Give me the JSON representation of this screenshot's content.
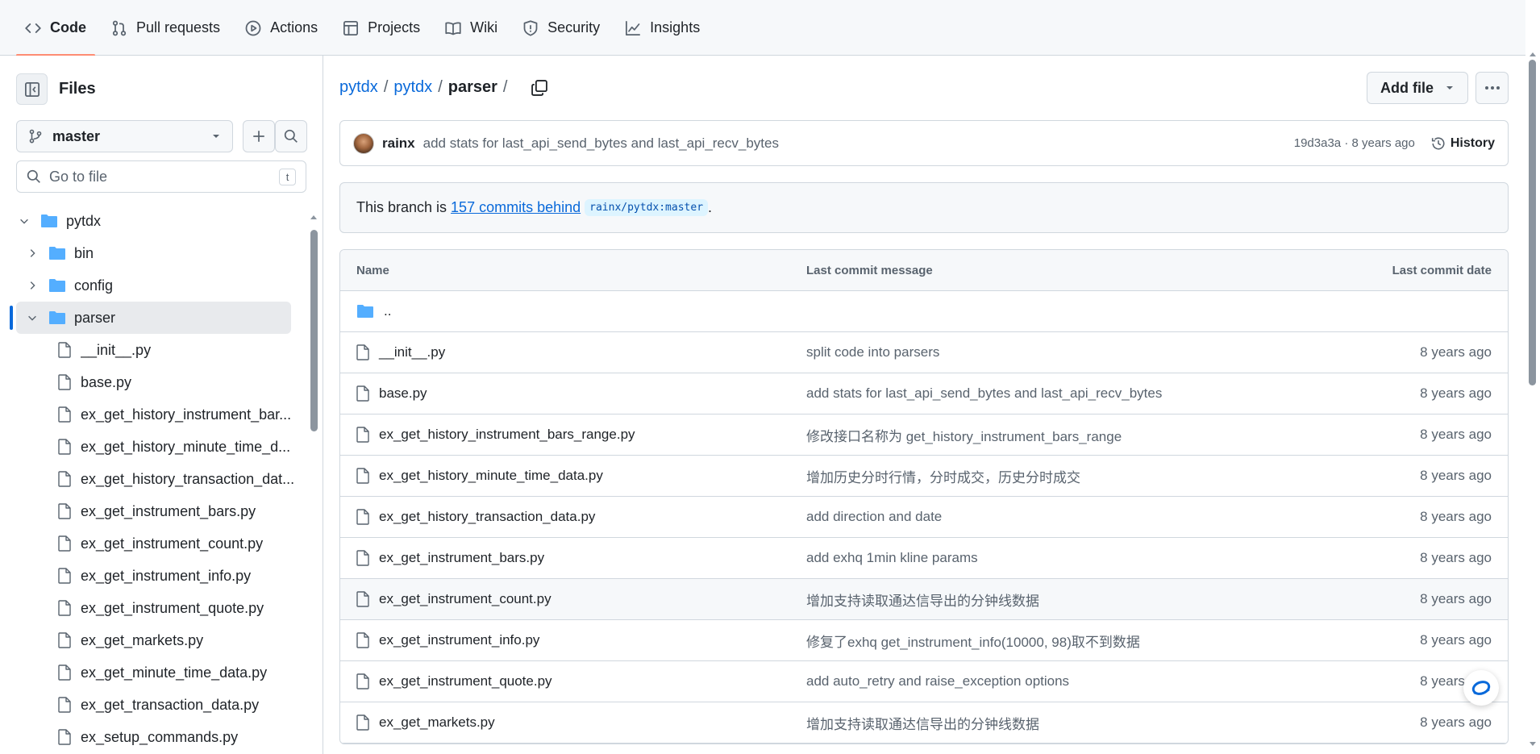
{
  "nav": {
    "tabs": [
      {
        "label": "Code",
        "icon": "code-icon"
      },
      {
        "label": "Pull requests",
        "icon": "pull-request-icon"
      },
      {
        "label": "Actions",
        "icon": "play-icon"
      },
      {
        "label": "Projects",
        "icon": "table-icon"
      },
      {
        "label": "Wiki",
        "icon": "book-icon"
      },
      {
        "label": "Security",
        "icon": "shield-icon"
      },
      {
        "label": "Insights",
        "icon": "graph-icon"
      }
    ]
  },
  "sidebar": {
    "title": "Files",
    "branch": "master",
    "goto_placeholder": "Go to file",
    "goto_shortcut": "t",
    "tree": [
      {
        "label": "pytdx",
        "type": "folder",
        "expanded": true
      },
      {
        "label": "bin",
        "type": "folder",
        "expanded": false
      },
      {
        "label": "config",
        "type": "folder",
        "expanded": false
      },
      {
        "label": "parser",
        "type": "folder",
        "expanded": true
      },
      {
        "label": "__init__.py",
        "type": "file"
      },
      {
        "label": "base.py",
        "type": "file"
      },
      {
        "label": "ex_get_history_instrument_bar...",
        "type": "file"
      },
      {
        "label": "ex_get_history_minute_time_d...",
        "type": "file"
      },
      {
        "label": "ex_get_history_transaction_dat...",
        "type": "file"
      },
      {
        "label": "ex_get_instrument_bars.py",
        "type": "file"
      },
      {
        "label": "ex_get_instrument_count.py",
        "type": "file"
      },
      {
        "label": "ex_get_instrument_info.py",
        "type": "file"
      },
      {
        "label": "ex_get_instrument_quote.py",
        "type": "file"
      },
      {
        "label": "ex_get_markets.py",
        "type": "file"
      },
      {
        "label": "ex_get_minute_time_data.py",
        "type": "file"
      },
      {
        "label": "ex_get_transaction_data.py",
        "type": "file"
      },
      {
        "label": "ex_setup_commands.py",
        "type": "file"
      }
    ]
  },
  "breadcrumb": {
    "root": "pytdx",
    "mid": "pytdx",
    "current": "parser",
    "sep": "/"
  },
  "toolbar": {
    "add_file": "Add file"
  },
  "commit": {
    "author": "rainx",
    "message": "add stats for last_api_send_bytes and last_api_recv_bytes",
    "meta": "19d3a3a · 8 years ago",
    "history_label": "History"
  },
  "branch_note": {
    "prefix": "This branch is",
    "link": "157 commits behind",
    "ref": "rainx/pytdx:master",
    "suffix": "."
  },
  "table": {
    "headers": {
      "name": "Name",
      "message": "Last commit message",
      "date": "Last commit date"
    },
    "parent": "..",
    "rows": [
      {
        "name": "__init__.py",
        "message": "split code into parsers",
        "date": "8 years ago"
      },
      {
        "name": "base.py",
        "message": "add stats for last_api_send_bytes and last_api_recv_bytes",
        "date": "8 years ago"
      },
      {
        "name": "ex_get_history_instrument_bars_range.py",
        "message": "修改接口名称为 get_history_instrument_bars_range",
        "date": "8 years ago"
      },
      {
        "name": "ex_get_history_minute_time_data.py",
        "message": "增加历史分时行情，分时成交，历史分时成交",
        "date": "8 years ago"
      },
      {
        "name": "ex_get_history_transaction_data.py",
        "message": "add direction and date",
        "date": "8 years ago"
      },
      {
        "name": "ex_get_instrument_bars.py",
        "message": "add exhq 1min kline params",
        "date": "8 years ago"
      },
      {
        "name": "ex_get_instrument_count.py",
        "message": "增加支持读取通达信导出的分钟线数据",
        "date": "8 years ago"
      },
      {
        "name": "ex_get_instrument_info.py",
        "message": "修复了exhq get_instrument_info(10000, 98)取不到数据",
        "date": "8 years ago"
      },
      {
        "name": "ex_get_instrument_quote.py",
        "message": "add auto_retry and raise_exception options",
        "date": "8 years ago"
      },
      {
        "name": "ex_get_markets.py",
        "message": "增加支持读取通达信导出的分钟线数据",
        "date": "8 years ago"
      }
    ]
  },
  "colors": {
    "link": "#0969da",
    "folder": "#54aeff",
    "tab_underline": "#fd8c73",
    "border": "#d0d7de",
    "muted": "#59636e"
  }
}
